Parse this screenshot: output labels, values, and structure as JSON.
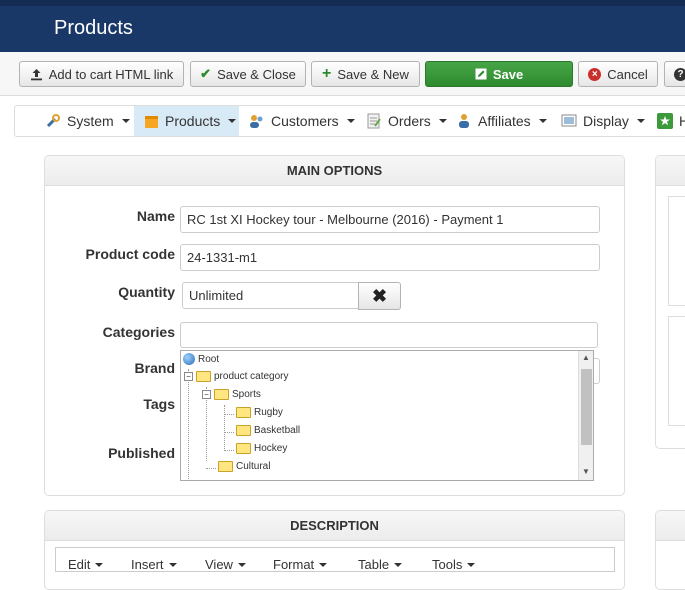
{
  "header": {
    "title": "Products"
  },
  "toolbar": {
    "add_to_cart": "Add to cart HTML link",
    "save_close": "Save & Close",
    "save_new": "Save & New",
    "save": "Save",
    "cancel": "Cancel",
    "help": "?"
  },
  "menu": {
    "system": "System",
    "products": "Products",
    "customers": "Customers",
    "orders": "Orders",
    "affiliates": "Affiliates",
    "display": "Display",
    "more": "H"
  },
  "main_options": {
    "title": "MAIN OPTIONS",
    "name_label": "Name",
    "name_value": "RC 1st XI Hockey tour - Melbourne (2016) - Payment 1",
    "code_label": "Product code",
    "code_value": "24-1331-m1",
    "quantity_label": "Quantity",
    "quantity_value": "Unlimited",
    "categories_label": "Categories",
    "brand_label": "Brand",
    "tags_label": "Tags",
    "published_label": "Published"
  },
  "tree": {
    "root": "Root",
    "product_category": "product category",
    "sports": "Sports",
    "rugby": "Rugby",
    "basketball": "Basketball",
    "hockey": "Hockey",
    "cultural": "Cultural"
  },
  "description": {
    "title": "DESCRIPTION",
    "edit": "Edit",
    "insert": "Insert",
    "view": "View",
    "format": "Format",
    "table": "Table",
    "tools": "Tools"
  }
}
